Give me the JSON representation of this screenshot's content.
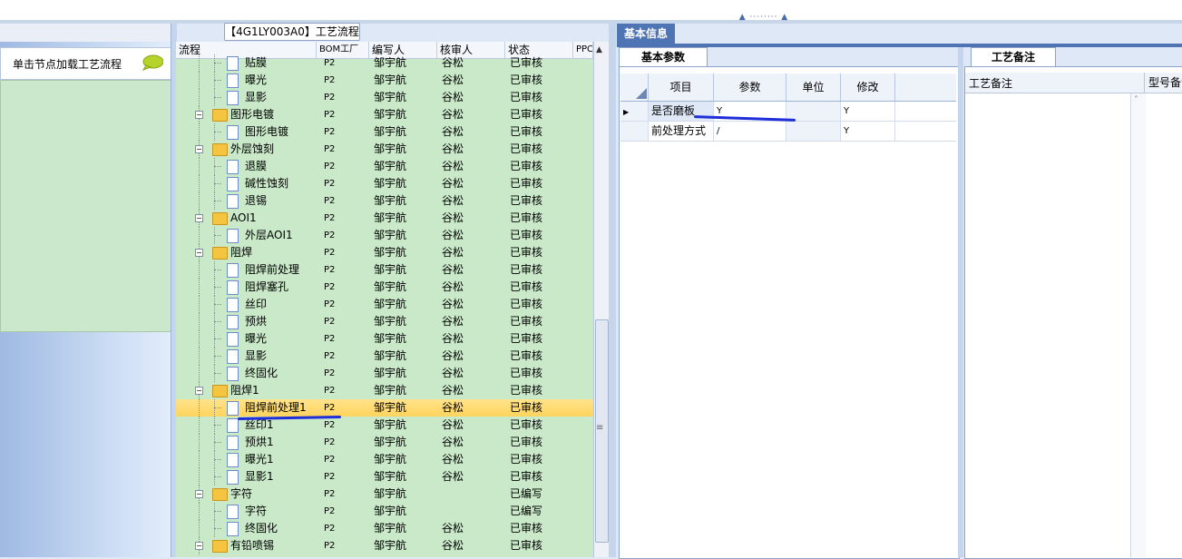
{
  "tree_panel": {
    "title": "【4G1LY003A0】工艺流程",
    "columns": [
      "流程",
      "BOM工厂",
      "编写人",
      "核审人",
      "状态",
      "PPC"
    ]
  },
  "left_panel": {
    "hint": "单击节点加载工艺流程"
  },
  "tree_rows": [
    {
      "level": 2,
      "kind": "doc",
      "name": "贴膜",
      "bom": "P2",
      "author": "邹宇航",
      "reviewer": "谷松",
      "status": "已审核"
    },
    {
      "level": 2,
      "kind": "doc",
      "name": "曝光",
      "bom": "P2",
      "author": "邹宇航",
      "reviewer": "谷松",
      "status": "已审核"
    },
    {
      "level": 2,
      "kind": "doc",
      "name": "显影",
      "bom": "P2",
      "author": "邹宇航",
      "reviewer": "谷松",
      "status": "已审核"
    },
    {
      "level": 1,
      "kind": "folder",
      "name": "图形电镀",
      "bom": "P2",
      "author": "邹宇航",
      "reviewer": "谷松",
      "status": "已审核"
    },
    {
      "level": 2,
      "kind": "doc",
      "name": "图形电镀",
      "bom": "P2",
      "author": "邹宇航",
      "reviewer": "谷松",
      "status": "已审核"
    },
    {
      "level": 1,
      "kind": "folder",
      "name": "外层蚀刻",
      "bom": "P2",
      "author": "邹宇航",
      "reviewer": "谷松",
      "status": "已审核"
    },
    {
      "level": 2,
      "kind": "doc",
      "name": "退膜",
      "bom": "P2",
      "author": "邹宇航",
      "reviewer": "谷松",
      "status": "已审核"
    },
    {
      "level": 2,
      "kind": "doc",
      "name": "碱性蚀刻",
      "bom": "P2",
      "author": "邹宇航",
      "reviewer": "谷松",
      "status": "已审核"
    },
    {
      "level": 2,
      "kind": "doc",
      "name": "退锡",
      "bom": "P2",
      "author": "邹宇航",
      "reviewer": "谷松",
      "status": "已审核"
    },
    {
      "level": 1,
      "kind": "folder",
      "name": "AOI1",
      "bom": "P2",
      "author": "邹宇航",
      "reviewer": "谷松",
      "status": "已审核"
    },
    {
      "level": 2,
      "kind": "doc",
      "name": "外层AOI1",
      "bom": "P2",
      "author": "邹宇航",
      "reviewer": "谷松",
      "status": "已审核"
    },
    {
      "level": 1,
      "kind": "folder",
      "name": "阻焊",
      "bom": "P2",
      "author": "邹宇航",
      "reviewer": "谷松",
      "status": "已审核"
    },
    {
      "level": 2,
      "kind": "doc",
      "name": "阻焊前处理",
      "bom": "P2",
      "author": "邹宇航",
      "reviewer": "谷松",
      "status": "已审核"
    },
    {
      "level": 2,
      "kind": "doc",
      "name": "阻焊塞孔",
      "bom": "P2",
      "author": "邹宇航",
      "reviewer": "谷松",
      "status": "已审核"
    },
    {
      "level": 2,
      "kind": "doc",
      "name": "丝印",
      "bom": "P2",
      "author": "邹宇航",
      "reviewer": "谷松",
      "status": "已审核"
    },
    {
      "level": 2,
      "kind": "doc",
      "name": "预烘",
      "bom": "P2",
      "author": "邹宇航",
      "reviewer": "谷松",
      "status": "已审核"
    },
    {
      "level": 2,
      "kind": "doc",
      "name": "曝光",
      "bom": "P2",
      "author": "邹宇航",
      "reviewer": "谷松",
      "status": "已审核"
    },
    {
      "level": 2,
      "kind": "doc",
      "name": "显影",
      "bom": "P2",
      "author": "邹宇航",
      "reviewer": "谷松",
      "status": "已审核"
    },
    {
      "level": 2,
      "kind": "doc",
      "name": "终固化",
      "bom": "P2",
      "author": "邹宇航",
      "reviewer": "谷松",
      "status": "已审核"
    },
    {
      "level": 1,
      "kind": "folder",
      "name": "阻焊1",
      "bom": "P2",
      "author": "邹宇航",
      "reviewer": "谷松",
      "status": "已审核"
    },
    {
      "level": 2,
      "kind": "doc",
      "name": "阻焊前处理1",
      "bom": "P2",
      "author": "邹宇航",
      "reviewer": "谷松",
      "status": "已审核",
      "selected": true
    },
    {
      "level": 2,
      "kind": "doc",
      "name": "丝印1",
      "bom": "P2",
      "author": "邹宇航",
      "reviewer": "谷松",
      "status": "已审核"
    },
    {
      "level": 2,
      "kind": "doc",
      "name": "预烘1",
      "bom": "P2",
      "author": "邹宇航",
      "reviewer": "谷松",
      "status": "已审核"
    },
    {
      "level": 2,
      "kind": "doc",
      "name": "曝光1",
      "bom": "P2",
      "author": "邹宇航",
      "reviewer": "谷松",
      "status": "已审核"
    },
    {
      "level": 2,
      "kind": "doc",
      "name": "显影1",
      "bom": "P2",
      "author": "邹宇航",
      "reviewer": "谷松",
      "status": "已审核"
    },
    {
      "level": 1,
      "kind": "folder",
      "name": "字符",
      "bom": "P2",
      "author": "邹宇航",
      "reviewer": "",
      "status": "已编写"
    },
    {
      "level": 2,
      "kind": "doc",
      "name": "字符",
      "bom": "P2",
      "author": "邹宇航",
      "reviewer": "",
      "status": "已编写"
    },
    {
      "level": 2,
      "kind": "doc",
      "name": "终固化",
      "bom": "P2",
      "author": "邹宇航",
      "reviewer": "谷松",
      "status": "已审核"
    },
    {
      "level": 1,
      "kind": "folder",
      "name": "有铅喷锡",
      "bom": "P2",
      "author": "邹宇航",
      "reviewer": "谷松",
      "status": "已审核"
    }
  ],
  "info_panel": {
    "tab_label": "基本信息",
    "basic_tab": "基本参数",
    "columns": [
      "项目",
      "参数",
      "单位",
      "修改"
    ],
    "rows": [
      {
        "item": "是否磨板",
        "param": "Y",
        "unit": "",
        "modify": "Y",
        "current": true
      },
      {
        "item": "前处理方式",
        "param": "/",
        "unit": "",
        "modify": "Y",
        "current": false
      }
    ]
  },
  "remark_panel": {
    "tab_label": "工艺备注",
    "columns": [
      "工艺备注",
      "型号备注"
    ]
  },
  "colors": {
    "tree_bg": "#c9e9c9",
    "selected_row": "#ffd45e",
    "info_tab": "#4f74b4",
    "annotation_ink": "#1f2ed8"
  }
}
